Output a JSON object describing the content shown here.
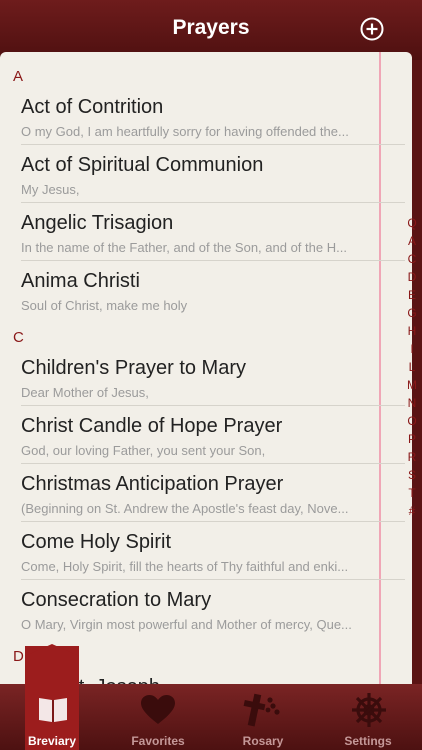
{
  "header": {
    "title": "Prayers",
    "add_icon": "plus-circle-icon"
  },
  "sections": [
    {
      "letter": "A"
    },
    {
      "letter": "C"
    },
    {
      "letter": "D"
    }
  ],
  "rows": [
    {
      "title": "Act of Contrition",
      "subtitle": "O my God, I am heartfully sorry for having offended the..."
    },
    {
      "title": "Act of Spiritual Communion",
      "subtitle": "My Jesus,"
    },
    {
      "title": "Angelic Trisagion",
      "subtitle": "In the name of the Father, and of the Son, and of the H..."
    },
    {
      "title": "Anima Christi",
      "subtitle": "Soul of Christ, make me holy"
    },
    {
      "title": "Children's Prayer to Mary",
      "subtitle": "Dear Mother of Jesus,"
    },
    {
      "title": "Christ Candle of Hope Prayer",
      "subtitle": "God, our loving Father, you sent your Son,"
    },
    {
      "title": "Christmas Anticipation Prayer",
      "subtitle": "(Beginning on St. Andrew the Apostle's feast day, Nove..."
    },
    {
      "title": "Come Holy Spirit",
      "subtitle": "Come, Holy Spirit, fill the hearts of Thy faithful and enki..."
    },
    {
      "title": "Consecration to Mary",
      "subtitle": "O Mary, Virgin most powerful and Mother of mercy, Que..."
    },
    {
      "title": "... to St. Joseph",
      "subtitle": ""
    }
  ],
  "index": [
    "Q",
    "A",
    "C",
    "D",
    "E",
    "G",
    "H",
    "I",
    "L",
    "M",
    "N",
    "O",
    "P",
    "R",
    "S",
    "T",
    "#"
  ],
  "tabs": [
    {
      "label": "Breviary",
      "icon": "book-icon",
      "active": true
    },
    {
      "label": "Favorites",
      "icon": "heart-icon",
      "active": false
    },
    {
      "label": "Rosary",
      "icon": "cross-icon",
      "active": false
    },
    {
      "label": "Settings",
      "icon": "wheel-icon",
      "active": false
    }
  ],
  "colors": {
    "accent": "#8a1818",
    "bar": "#5a1414",
    "page": "#f2efe8"
  }
}
